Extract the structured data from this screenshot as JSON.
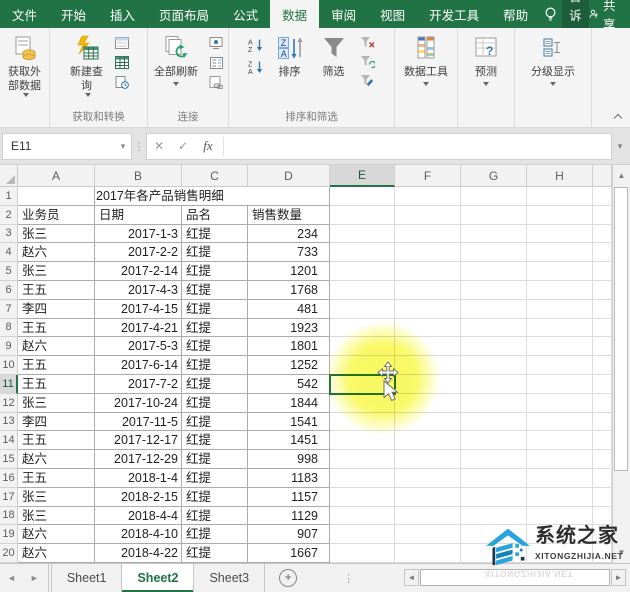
{
  "colors": {
    "excel_green": "#217346",
    "highlight_yellow": "#f8f855",
    "logo_blue": "#29a3dc"
  },
  "ribbon_tabs": {
    "file": "文件",
    "home": "开始",
    "insert": "插入",
    "page_layout": "页面布局",
    "formulas": "公式",
    "data": "数据",
    "review": "审阅",
    "view": "视图",
    "developer": "开发工具",
    "help": "帮助",
    "tell_me": "告诉我",
    "share": "共享"
  },
  "ribbon": {
    "get_external_data": "获取外部数据",
    "new_query": "新建查询",
    "refresh_all": "全部刷新",
    "sort": "排序",
    "filter": "筛选",
    "data_tools": "数据工具",
    "forecast": "预测",
    "outline": "分级显示",
    "groups": {
      "get_transform": "获取和转换",
      "connections": "连接",
      "sort_filter": "排序和筛选"
    }
  },
  "formula_bar": {
    "name_box": "E11",
    "fx_label": "fx",
    "value": ""
  },
  "icons": {
    "cancel": "✕",
    "enter": "✓",
    "caret_down": "▾",
    "dots": "⋮",
    "nav_left": "◄",
    "nav_right": "►",
    "scroll_up": "▲",
    "scroll_down": "▼",
    "scroll_left": "◄",
    "scroll_right": "►",
    "plus": "+"
  },
  "grid": {
    "column_labels": [
      "A",
      "B",
      "C",
      "D",
      "E",
      "F",
      "G",
      "H"
    ],
    "visible_row_count": 20,
    "selected_cell": "E11",
    "selected_column": "E",
    "selected_row": 11,
    "title": "2017年各产品销售明细",
    "headers": [
      "业务员",
      "日期",
      "品名",
      "销售数量"
    ],
    "rows": [
      [
        "张三",
        "2017-1-3",
        "红提",
        "234"
      ],
      [
        "赵六",
        "2017-2-2",
        "红提",
        "733"
      ],
      [
        "张三",
        "2017-2-14",
        "红提",
        "1201"
      ],
      [
        "王五",
        "2017-4-3",
        "红提",
        "1768"
      ],
      [
        "李四",
        "2017-4-15",
        "红提",
        "481"
      ],
      [
        "王五",
        "2017-4-21",
        "红提",
        "1923"
      ],
      [
        "赵六",
        "2017-5-3",
        "红提",
        "1801"
      ],
      [
        "王五",
        "2017-6-14",
        "红提",
        "1252"
      ],
      [
        "王五",
        "2017-7-2",
        "红提",
        "542"
      ],
      [
        "张三",
        "2017-10-24",
        "红提",
        "1844"
      ],
      [
        "李四",
        "2017-11-5",
        "红提",
        "1541"
      ],
      [
        "王五",
        "2017-12-17",
        "红提",
        "1451"
      ],
      [
        "赵六",
        "2017-12-29",
        "红提",
        "998"
      ],
      [
        "王五",
        "2018-1-4",
        "红提",
        "1183"
      ],
      [
        "张三",
        "2018-2-15",
        "红提",
        "1157"
      ],
      [
        "张三",
        "2018-4-4",
        "红提",
        "1129"
      ],
      [
        "赵六",
        "2018-4-10",
        "红提",
        "907"
      ],
      [
        "赵六",
        "2018-4-22",
        "红提",
        "1667"
      ]
    ]
  },
  "sheet_bar": {
    "tabs": [
      "Sheet1",
      "Sheet2",
      "Sheet3"
    ],
    "active_tab": "Sheet2"
  },
  "watermark": {
    "title": "系统之家",
    "url": "XITONGZHIJIA.NET"
  }
}
